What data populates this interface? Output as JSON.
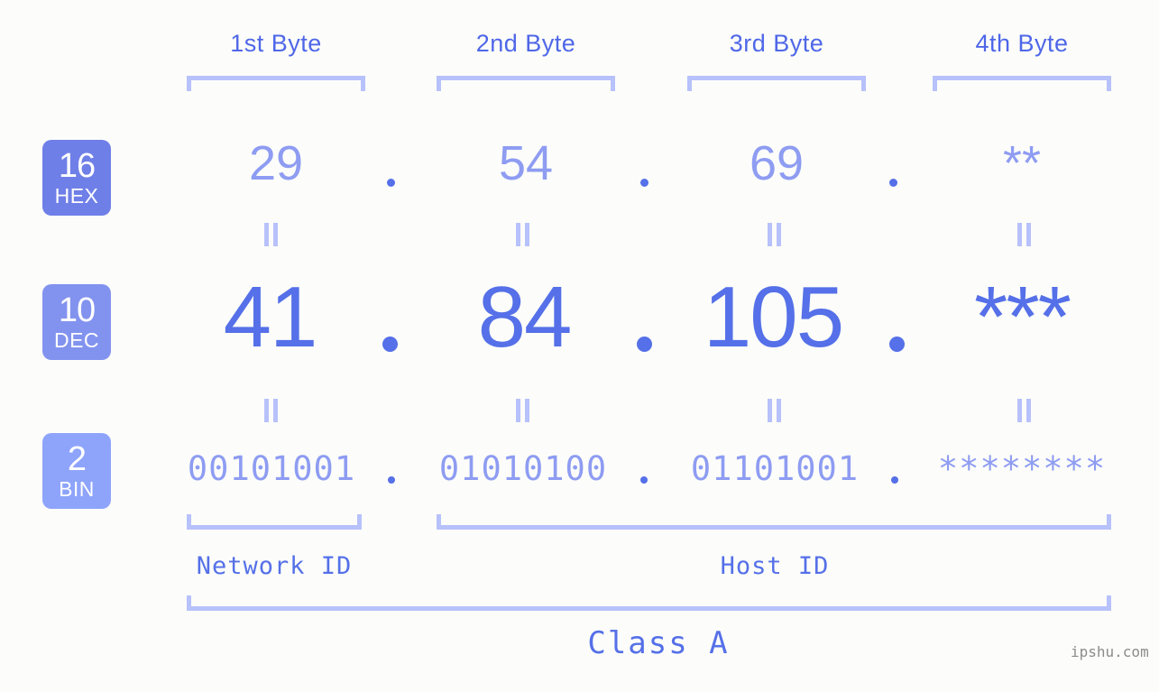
{
  "background_color": "#fcfdfa",
  "accent_strong": "#5570e8",
  "accent_light": "#8e9cf2",
  "accent_pale": "#b7c1fb",
  "byte_headers": [
    {
      "label": "1st Byte"
    },
    {
      "label": "2nd Byte"
    },
    {
      "label": "3rd Byte"
    },
    {
      "label": "4th Byte"
    }
  ],
  "rows": [
    {
      "badge": {
        "number": "16",
        "name": "HEX",
        "color": "#6f7fe8"
      },
      "values": [
        "29",
        "54",
        "69",
        "**"
      ]
    },
    {
      "badge": {
        "number": "10",
        "name": "DEC",
        "color": "#8293ef"
      },
      "values": [
        "41",
        "84",
        "105",
        "***"
      ]
    },
    {
      "badge": {
        "number": "2",
        "name": "BIN",
        "color": "#8ea4fb"
      },
      "values": [
        "00101001",
        "01010100",
        "01101001",
        "********"
      ]
    }
  ],
  "separator": ".",
  "equals_mark": "=",
  "sections": [
    {
      "label": "Network ID"
    },
    {
      "label": "Host ID"
    }
  ],
  "class_label": "Class A",
  "watermark": "ipshu.com"
}
